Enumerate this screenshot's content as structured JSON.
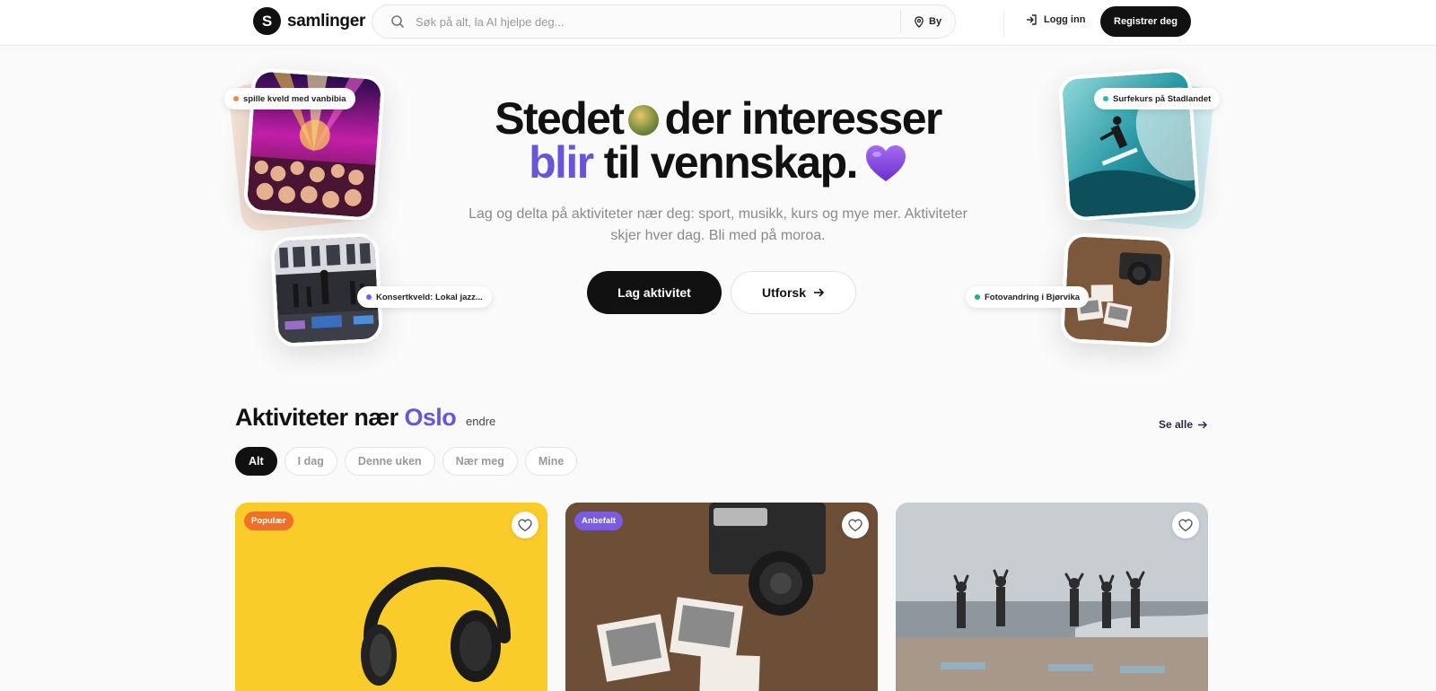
{
  "header": {
    "logo_letter": "S",
    "logo_text": "samlinger",
    "search_placeholder": "Søk på alt, la AI hjelpe deg...",
    "city_label": "By",
    "login_label": "Logg inn",
    "register_label": "Registrer deg"
  },
  "hero": {
    "title_part1": "Stedet",
    "title_part2": "der interesser",
    "title_accent": "blir",
    "title_part3": "til vennskap.",
    "subtitle": "Lag og delta på aktiviteter nær deg: sport, musikk, kurs og mye mer. Aktiviteter skjer hver dag. Bli med på moroa.",
    "primary_button": "Lag aktivitet",
    "secondary_button": "Utforsk",
    "floating_tags": [
      {
        "label": "spille kveld med vanbibia",
        "color": "#f08a3c"
      },
      {
        "label": "Konsertkveld: Lokal jazz...",
        "color": "#7a5ce0"
      },
      {
        "label": "Surfekurs på Stadlandet",
        "color": "#2bb3c0"
      },
      {
        "label": "Fotovandring i Bjørvika",
        "color": "#1fb37a"
      }
    ]
  },
  "section": {
    "title": "Aktiviteter nær",
    "city": "Oslo",
    "change_label": "endre",
    "see_all_label": "Se alle",
    "filters": [
      "Alt",
      "I dag",
      "Denne uken",
      "Nær meg",
      "Mine"
    ],
    "active_filter": "Alt"
  },
  "cards": [
    {
      "badge": "Populær",
      "badge_color": "#f0702a",
      "image": "headphones-on-yellow"
    },
    {
      "badge": "Anbefalt",
      "badge_color": "#7a5ce0",
      "image": "vintage-camera-and-photos"
    },
    {
      "badge": "",
      "badge_color": "",
      "image": "yoga-on-beach"
    }
  ],
  "colors": {
    "accent": "#6a55d6",
    "primary": "#111111"
  }
}
